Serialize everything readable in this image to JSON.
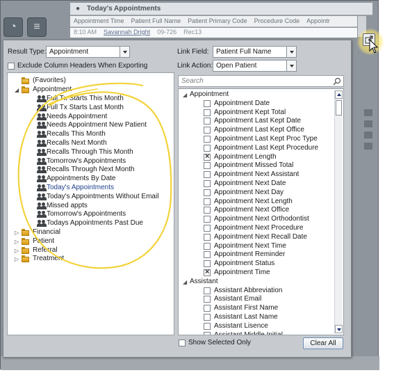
{
  "background": {
    "title": "Today's Appointments",
    "columns": [
      "Appointment Time",
      "Patient Full Name",
      "Patient Primary Code",
      "Procedure Code",
      "Appointr"
    ],
    "row": [
      "8:10 AM",
      "Savannah Dright",
      "09-726",
      "Rec13"
    ]
  },
  "dialog": {
    "result_type_label": "Result Type:",
    "result_type_value": "Appointment",
    "exclude_headers_label": "Exclude Column Headers When Exporting",
    "link_field_label": "Link Field:",
    "link_field_value": "Patient Full Name",
    "link_action_label": "Link Action:",
    "link_action_value": "Open Patient",
    "search_placeholder": "Search",
    "show_selected_label": "Show Selected Only",
    "clear_all_label": "Clear All"
  },
  "tree": {
    "favorites": "(Favorites)",
    "appointment": "Appointment",
    "queries": [
      "Full Tx Starts This Month",
      "Full Tx Starts Last Month",
      "Needs Appointment",
      "Needs Appointment New Patient",
      "Recalls This Month",
      "Recalls Next Month",
      "Recalls Through This Month",
      "Tomorrow's Appointments",
      "Recalls Through Next Month",
      "Appointments By Date",
      "Today's Appointments",
      "Today's Appointments Without Email",
      "Missed appts",
      "Tomorrow's Appointments",
      "Todays Appointments Past Due"
    ],
    "selected_index": 10,
    "folders": [
      "Financial",
      "Patient",
      "Referral",
      "Treatment"
    ]
  },
  "fields": {
    "group1": "Appointment",
    "items1": [
      {
        "label": "Appointment Date",
        "checked": false
      },
      {
        "label": "Appointment Kept Total",
        "checked": false
      },
      {
        "label": "Appointment Last Kept Date",
        "checked": false
      },
      {
        "label": "Appointment Last Kept Office",
        "checked": false
      },
      {
        "label": "Appointment Last Kept Proc Type",
        "checked": false
      },
      {
        "label": "Appointment Last Kept Procedure",
        "checked": false
      },
      {
        "label": "Appointment Length",
        "checked": true
      },
      {
        "label": "Appointment Missed Total",
        "checked": false
      },
      {
        "label": "Appointment Next Assistant",
        "checked": false
      },
      {
        "label": "Appointment Next Date",
        "checked": false
      },
      {
        "label": "Appointment Next Day",
        "checked": false
      },
      {
        "label": "Appointment Next Length",
        "checked": false
      },
      {
        "label": "Appointment Next Office",
        "checked": false
      },
      {
        "label": "Appointment Next Orthodontist",
        "checked": false
      },
      {
        "label": "Appointment Next Procedure",
        "checked": false
      },
      {
        "label": "Appointment Next Recall Date",
        "checked": false
      },
      {
        "label": "Appointment Next Time",
        "checked": false
      },
      {
        "label": "Appointment Reminder",
        "checked": false
      },
      {
        "label": "Appointment Status",
        "checked": false
      },
      {
        "label": "Appointment Time",
        "checked": true
      }
    ],
    "group2": "Assistant",
    "items2": [
      {
        "label": "Assistant Abbreviation",
        "checked": false
      },
      {
        "label": "Assistant Email",
        "checked": false
      },
      {
        "label": "Assistant First Name",
        "checked": false
      },
      {
        "label": "Assistant Last Name",
        "checked": false
      },
      {
        "label": "Assistant Lisence",
        "checked": false
      },
      {
        "label": "Assistant Middle Initial",
        "checked": false
      }
    ]
  },
  "colors": {
    "highlight": "#f2d33a",
    "selected_text": "#1e3f8a",
    "dialog_bg": "#c7cbd0"
  }
}
